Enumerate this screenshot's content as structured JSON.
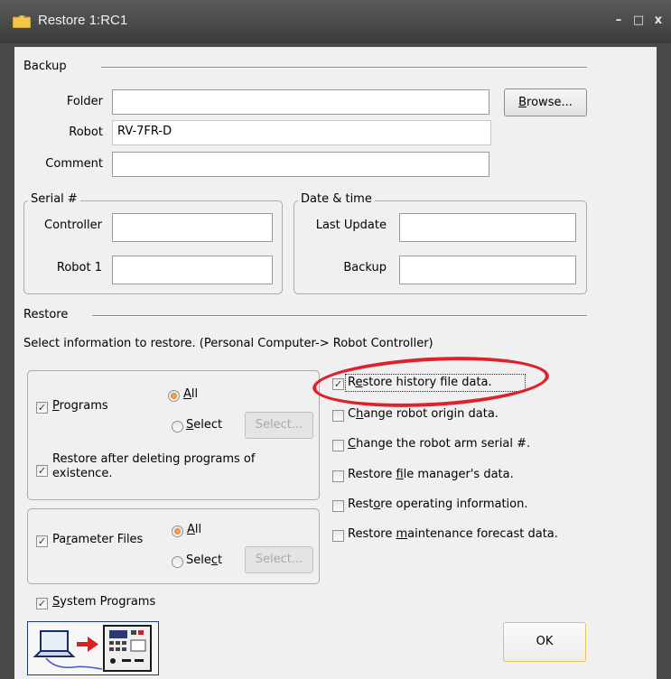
{
  "window": {
    "title": "Restore 1:RC1",
    "minimize_glyph": "–",
    "maximize_glyph": "□",
    "close_glyph": "x"
  },
  "backup": {
    "section_label": "Backup",
    "folder_label": "Folder",
    "folder_value": "",
    "robot_label": "Robot",
    "robot_value": "RV-7FR-D",
    "comment_label": "Comment",
    "comment_value": "",
    "browse_label": "Browse..."
  },
  "serial": {
    "group_title": "Serial #",
    "controller_label": "Controller",
    "controller_value": "",
    "robot1_label": "Robot 1",
    "robot1_value": ""
  },
  "datetime": {
    "group_title": "Date & time",
    "last_update_label": "Last Update",
    "last_update_value": "",
    "backup_label": "Backup",
    "backup_value": ""
  },
  "restore": {
    "section_label": "Restore",
    "instruction": "Select information to restore. (Personal Computer-> Robot Controller)",
    "programs_group": {
      "programs_label": "Programs",
      "programs_checked": true,
      "all_label": "All",
      "select_label": "Select",
      "mode_selected": "All",
      "select_button": "Select...",
      "delete_before_label_line1": "Restore after deleting programs of",
      "delete_before_label_line2": "existence.",
      "delete_before_checked": true
    },
    "parameter_group": {
      "parameter_label": "Parameter Files",
      "parameter_checked": true,
      "all_label": "All",
      "select_label": "Select",
      "mode_selected": "All",
      "select_button": "Select..."
    },
    "system_programs_label": "System Programs",
    "system_programs_checked": true,
    "options": [
      {
        "label": "Restore history file data.",
        "checked": true
      },
      {
        "label": "Change robot origin data.",
        "checked": false
      },
      {
        "label": "Change the robot arm serial #.",
        "checked": false
      },
      {
        "label": "Restore file manager's data.",
        "checked": false
      },
      {
        "label": "Restore operating information.",
        "checked": false
      },
      {
        "label": "Restore maintenance forecast data.",
        "checked": false
      }
    ],
    "check_glyph": "✓"
  },
  "ok_label": "OK",
  "colors": {
    "highlight_circle": "#e0202a",
    "radio_selected": "#d9741b",
    "titlebar": "#3c3c3c",
    "diagram_border": "#203880"
  }
}
